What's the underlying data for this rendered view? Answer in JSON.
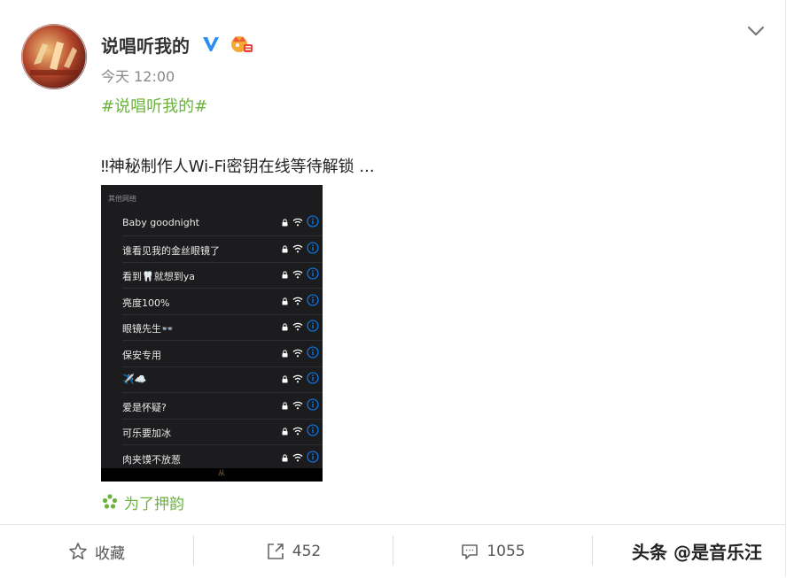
{
  "post": {
    "username": "说唱听我的",
    "time": "今天 12:00",
    "topic": "#说唱听我的#",
    "text": "‼神秘制作人Wi-Fi密钥在线等待解锁 ...",
    "location": "为了押韵"
  },
  "wifi_screenshot": {
    "header": "其他网络",
    "networks": [
      {
        "name": "Baby goodnight"
      },
      {
        "name": "谁看见我的金丝眼镜了"
      },
      {
        "name": "看到🦷就想到ya"
      },
      {
        "name": "亮度100%"
      },
      {
        "name": "眼镜先生👓"
      },
      {
        "name": "保安专用"
      },
      {
        "name": "✈️☁️"
      },
      {
        "name": "爱是怀疑?"
      },
      {
        "name": "可乐要加冰"
      },
      {
        "name": "肉夹馍不放葱"
      }
    ],
    "bottom": "从"
  },
  "footer": {
    "favorite_label": "收藏",
    "repost_count": "452",
    "comment_count": "1055"
  },
  "watermark": "头条 @是音乐汪",
  "colors": {
    "topic_green": "#6bb33c",
    "verified_blue": "#2a8ef0",
    "wifi_bg": "#1c1c1e",
    "info_blue": "#0a84ff"
  }
}
